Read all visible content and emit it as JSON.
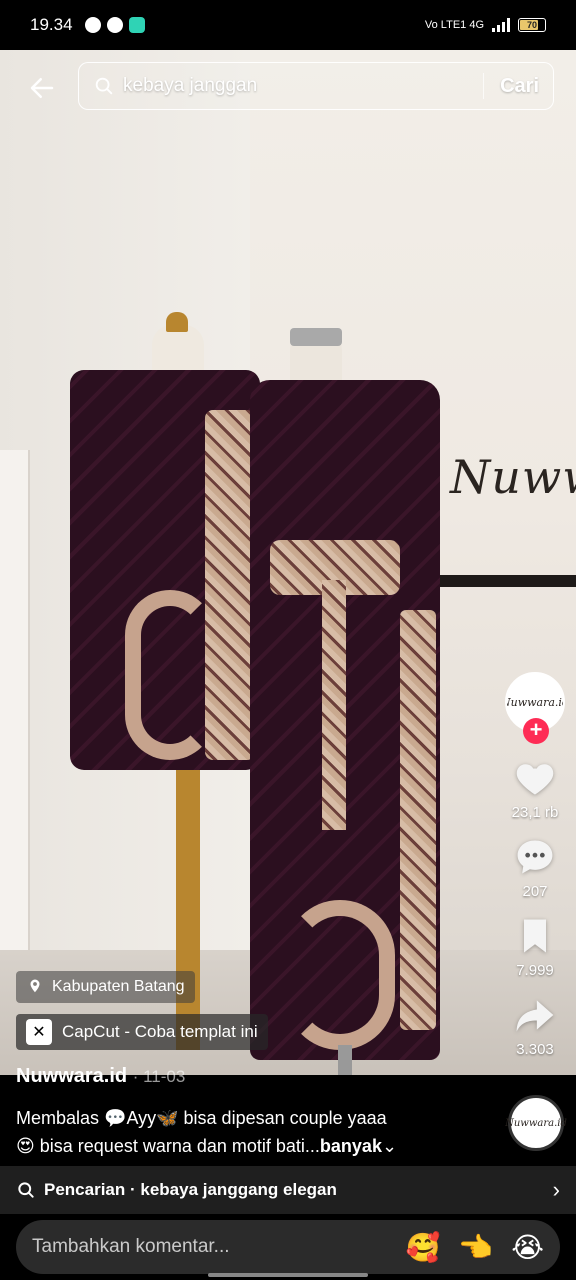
{
  "status_bar": {
    "time": "19.34",
    "network": "Vo LTE1 4G",
    "battery": "70"
  },
  "search": {
    "query": "kebaya janggan",
    "button_label": "Cari"
  },
  "video": {
    "brand_text": "Nuwwara.",
    "avatar_text": "Nuwwara.id"
  },
  "actions": {
    "likes": "23,1 rb",
    "comments": "207",
    "saves": "7.999",
    "shares": "3.303"
  },
  "overlay": {
    "location": "Kabupaten Batang",
    "capcut": "CapCut - Coba templat ini"
  },
  "post": {
    "author": "Nuwwara.id",
    "date": "· 11-03",
    "caption_line1": "Membalas 💬Ayy🦋  bisa dipesan couple yaaa",
    "caption_line2": "😍 bisa request warna dan motif bati...",
    "more_label": "banyak",
    "more_chevron": "⌄"
  },
  "suggestion": {
    "text": "Pencarian · kebaya janggang elegan",
    "chevron": "›"
  },
  "comment": {
    "placeholder": "Tambahkan komentar...",
    "emojis": [
      "🥰",
      "👈",
      "😭"
    ]
  }
}
